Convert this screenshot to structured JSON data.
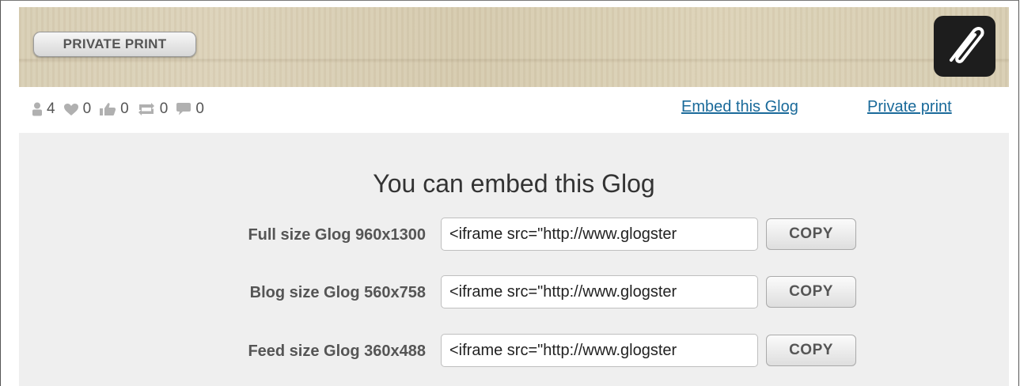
{
  "header": {
    "private_print_label": "PRIVATE PRINT",
    "attachment_icon": "paperclip-icon"
  },
  "stats": [
    {
      "icon": "user-icon",
      "value": "4"
    },
    {
      "icon": "heart-icon",
      "value": "0"
    },
    {
      "icon": "thumbs-up-icon",
      "value": "0"
    },
    {
      "icon": "repost-icon",
      "value": "0"
    },
    {
      "icon": "comment-icon",
      "value": "0"
    }
  ],
  "links": {
    "embed": "Embed this Glog",
    "private_print": "Private print"
  },
  "embed_panel": {
    "title": "You can embed this Glog",
    "copy_label": "COPY",
    "rows": [
      {
        "label": "Full size Glog 960x1300",
        "value": "<iframe src=\"http://www.glogster"
      },
      {
        "label": "Blog size Glog 560x758",
        "value": "<iframe src=\"http://www.glogster"
      },
      {
        "label": "Feed size Glog 360x488",
        "value": "<iframe src=\"http://www.glogster"
      }
    ]
  },
  "colors": {
    "link": "#1a6a9a",
    "panel_bg": "#efefef",
    "icon_gray": "#b0b0b0"
  }
}
